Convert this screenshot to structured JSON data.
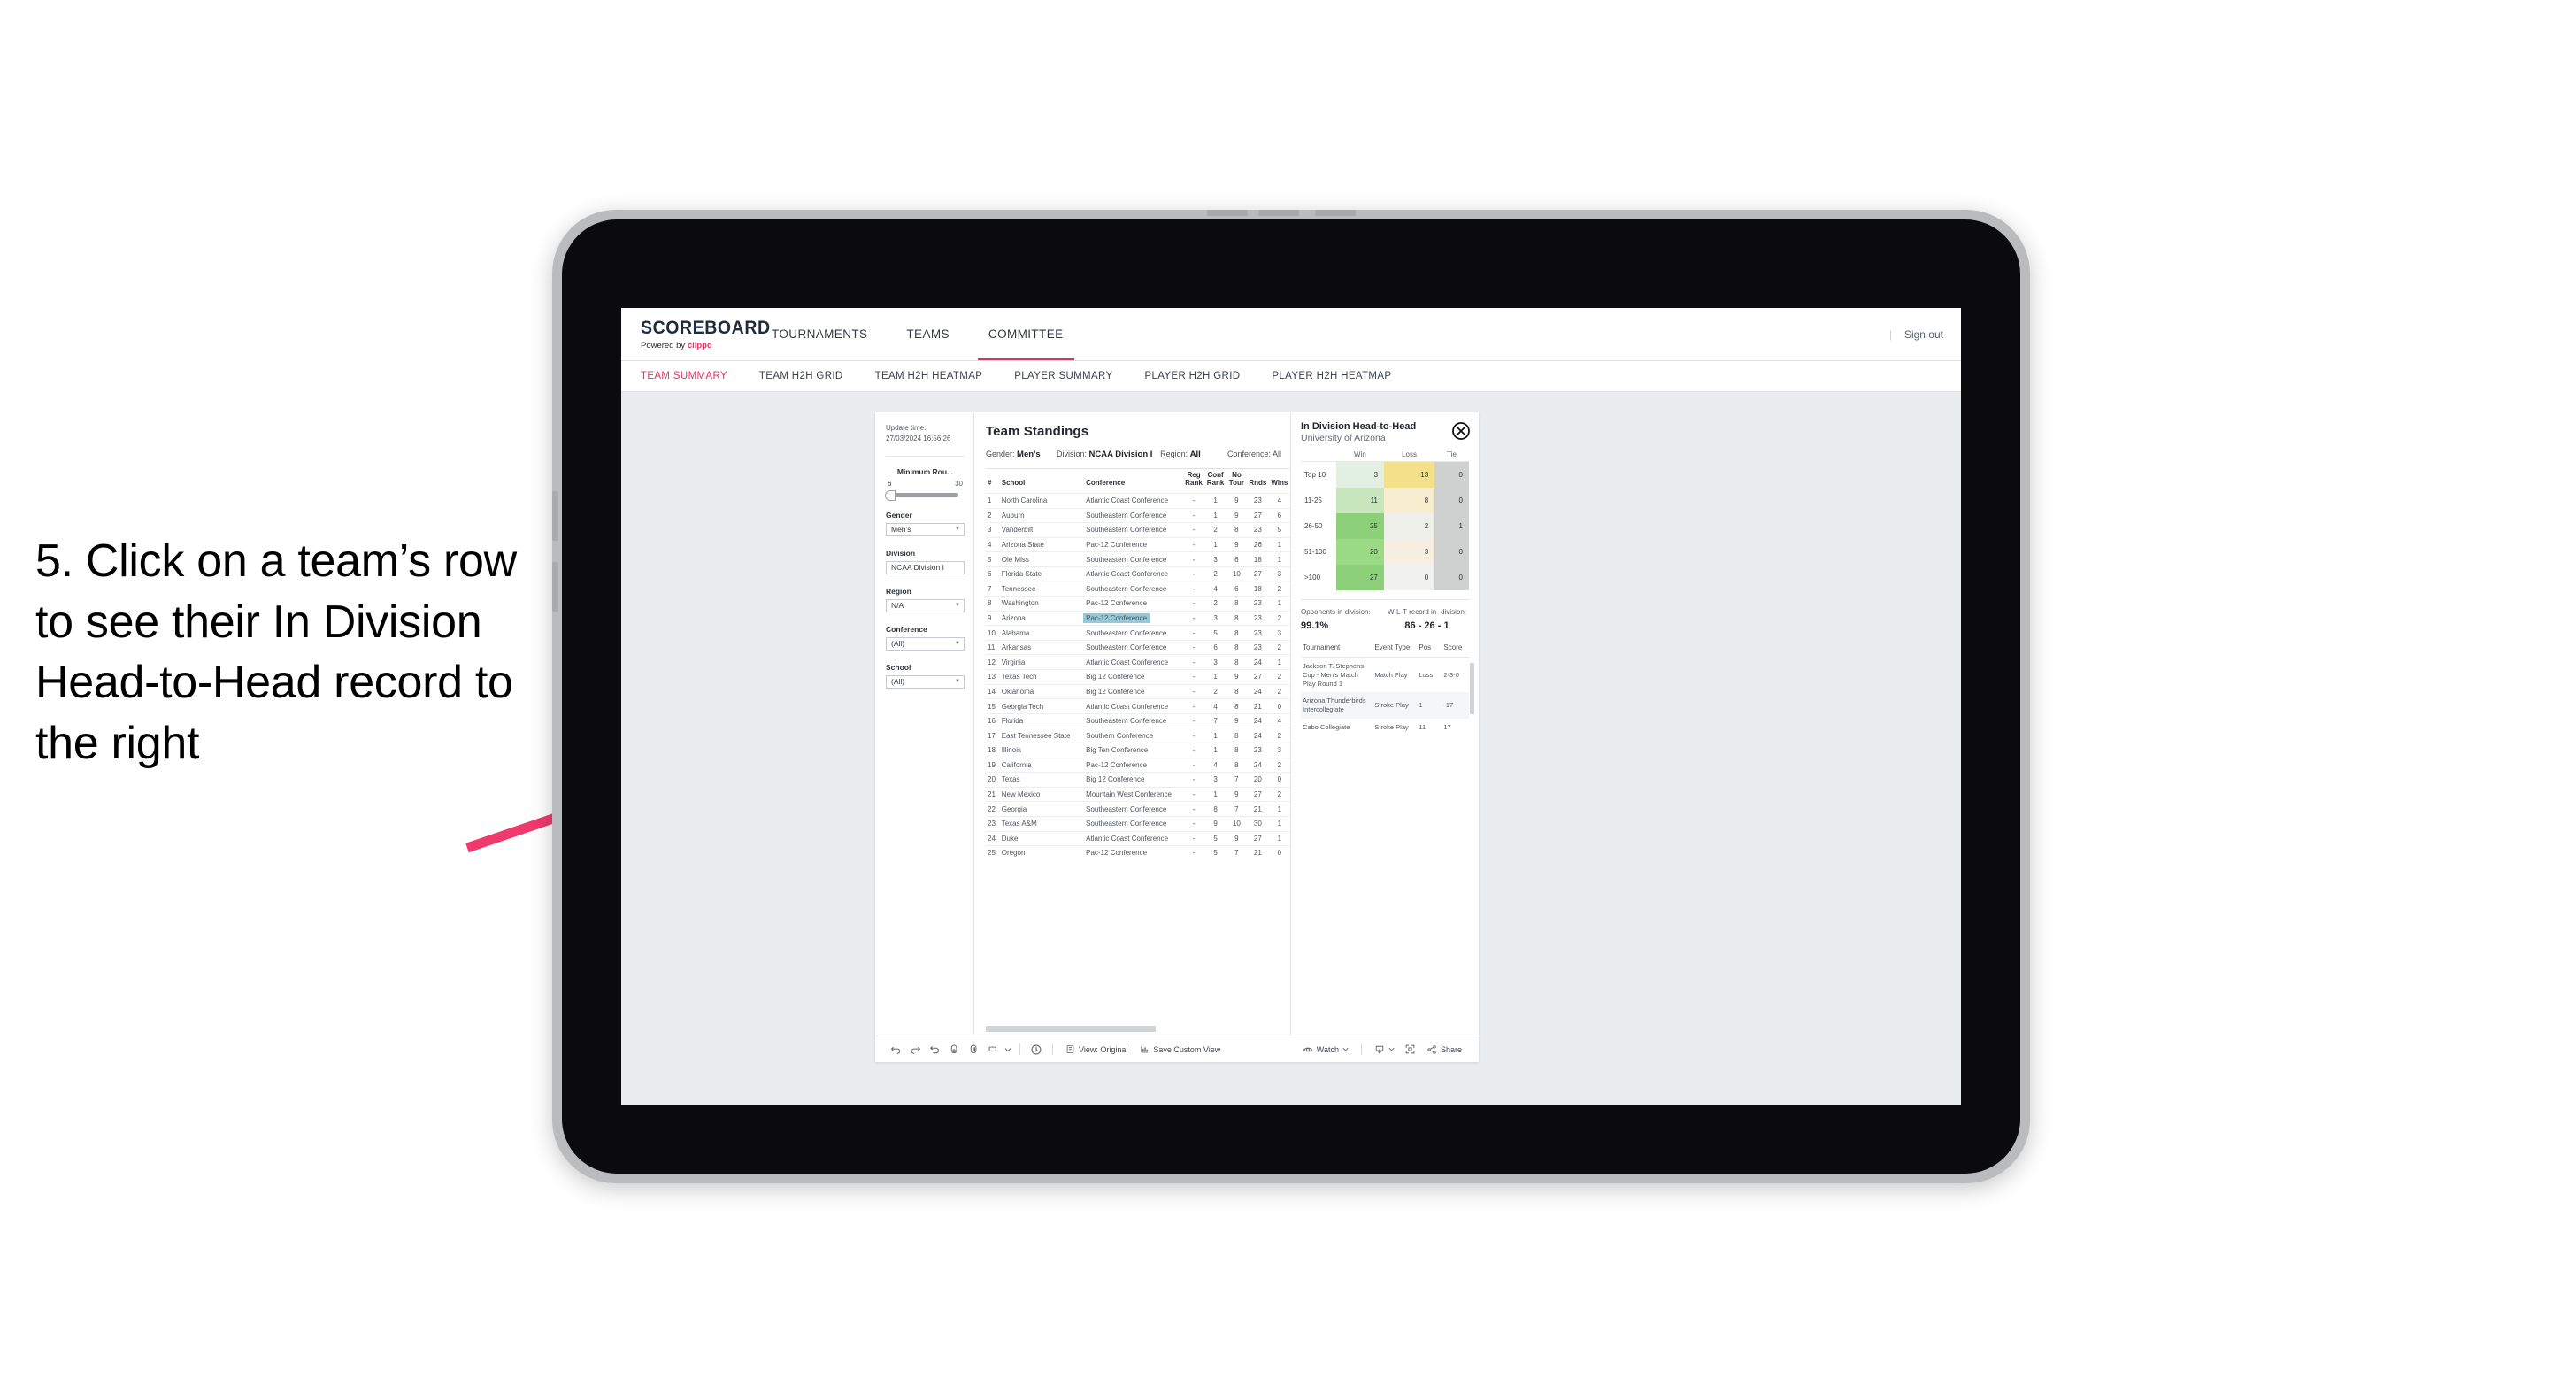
{
  "annotation": {
    "text": "5. Click on a team’s row to see their In Division Head-to-Head record to the right",
    "arrow_color": "#ef3a6e"
  },
  "navbar": {
    "brand_title": "SCOREBOARD",
    "brand_sub_prefix": "Powered by ",
    "brand_sub_name": "clippd",
    "items": [
      {
        "label": "TOURNAMENTS",
        "active": false
      },
      {
        "label": "TEAMS",
        "active": false
      },
      {
        "label": "COMMITTEE",
        "active": true
      }
    ],
    "divider": "|",
    "signout": "Sign out",
    "accent_color": "#c93a5b"
  },
  "subnav": {
    "items": [
      {
        "label": "TEAM SUMMARY",
        "active": true
      },
      {
        "label": "TEAM H2H GRID",
        "active": false
      },
      {
        "label": "TEAM H2H HEATMAP",
        "active": false
      },
      {
        "label": "PLAYER SUMMARY",
        "active": false
      },
      {
        "label": "PLAYER H2H GRID",
        "active": false
      },
      {
        "label": "PLAYER H2H HEATMAP",
        "active": false
      }
    ],
    "active_color": "#e8315e"
  },
  "filters": {
    "update_time_label": "Update time:",
    "update_time_value": "27/03/2024 16:56:26",
    "slider": {
      "label": "Minimum Rou...",
      "min": "6",
      "max": "30"
    },
    "selects": [
      {
        "label": "Gender",
        "value": "Men’s"
      },
      {
        "label": "Division",
        "value": "NCAA Division I"
      },
      {
        "label": "Region",
        "value": "N/A"
      },
      {
        "label": "Conference",
        "value": "(All)"
      },
      {
        "label": "School",
        "value": "(All)"
      }
    ]
  },
  "standings": {
    "title": "Team Standings",
    "summary": [
      {
        "label": "Gender:",
        "value": "Men’s"
      },
      {
        "label": "Division:",
        "value": "NCAA Division I"
      },
      {
        "label": "Region:",
        "value": "All"
      },
      {
        "label": "Conference:",
        "value": "All"
      }
    ],
    "columns": [
      "#",
      "School",
      "Conference",
      "Reg Rank",
      "Conf Rank",
      "No Tour",
      "Rnds",
      "Wins"
    ],
    "columns_multiline": [
      {
        "l1": "#",
        "l2": ""
      },
      {
        "l1": "School",
        "l2": ""
      },
      {
        "l1": "Conference",
        "l2": ""
      },
      {
        "l1": "Reg",
        "l2": "Rank"
      },
      {
        "l1": "Conf",
        "l2": "Rank"
      },
      {
        "l1": "No",
        "l2": "Tour"
      },
      {
        "l1": "Rnds",
        "l2": ""
      },
      {
        "l1": "Wins",
        "l2": ""
      }
    ],
    "highlight_color": "#93cada",
    "selected_row": 9,
    "rows": [
      {
        "rank": "1",
        "school": "North Carolina",
        "conference": "Atlantic Coast Conference",
        "reg": "-",
        "conf": "1",
        "notour": "9",
        "rnds": "23",
        "wins": "4"
      },
      {
        "rank": "2",
        "school": "Auburn",
        "conference": "Southeastern Conference",
        "reg": "-",
        "conf": "1",
        "notour": "9",
        "rnds": "27",
        "wins": "6"
      },
      {
        "rank": "3",
        "school": "Vanderbilt",
        "conference": "Southeastern Conference",
        "reg": "-",
        "conf": "2",
        "notour": "8",
        "rnds": "23",
        "wins": "5"
      },
      {
        "rank": "4",
        "school": "Arizona State",
        "conference": "Pac-12 Conference",
        "reg": "-",
        "conf": "1",
        "notour": "9",
        "rnds": "26",
        "wins": "1"
      },
      {
        "rank": "5",
        "school": "Ole Miss",
        "conference": "Southeastern Conference",
        "reg": "-",
        "conf": "3",
        "notour": "6",
        "rnds": "18",
        "wins": "1"
      },
      {
        "rank": "6",
        "school": "Florida State",
        "conference": "Atlantic Coast Conference",
        "reg": "-",
        "conf": "2",
        "notour": "10",
        "rnds": "27",
        "wins": "3"
      },
      {
        "rank": "7",
        "school": "Tennessee",
        "conference": "Southeastern Conference",
        "reg": "-",
        "conf": "4",
        "notour": "6",
        "rnds": "18",
        "wins": "2"
      },
      {
        "rank": "8",
        "school": "Washington",
        "conference": "Pac-12 Conference",
        "reg": "-",
        "conf": "2",
        "notour": "8",
        "rnds": "23",
        "wins": "1"
      },
      {
        "rank": "9",
        "school": "Arizona",
        "conference": "Pac-12 Conference",
        "reg": "-",
        "conf": "3",
        "notour": "8",
        "rnds": "23",
        "wins": "2"
      },
      {
        "rank": "10",
        "school": "Alabama",
        "conference": "Southeastern Conference",
        "reg": "-",
        "conf": "5",
        "notour": "8",
        "rnds": "23",
        "wins": "3"
      },
      {
        "rank": "11",
        "school": "Arkansas",
        "conference": "Southeastern Conference",
        "reg": "-",
        "conf": "6",
        "notour": "8",
        "rnds": "23",
        "wins": "2"
      },
      {
        "rank": "12",
        "school": "Virginia",
        "conference": "Atlantic Coast Conference",
        "reg": "-",
        "conf": "3",
        "notour": "8",
        "rnds": "24",
        "wins": "1"
      },
      {
        "rank": "13",
        "school": "Texas Tech",
        "conference": "Big 12 Conference",
        "reg": "-",
        "conf": "1",
        "notour": "9",
        "rnds": "27",
        "wins": "2"
      },
      {
        "rank": "14",
        "school": "Oklahoma",
        "conference": "Big 12 Conference",
        "reg": "-",
        "conf": "2",
        "notour": "8",
        "rnds": "24",
        "wins": "2"
      },
      {
        "rank": "15",
        "school": "Georgia Tech",
        "conference": "Atlantic Coast Conference",
        "reg": "-",
        "conf": "4",
        "notour": "8",
        "rnds": "21",
        "wins": "0"
      },
      {
        "rank": "16",
        "school": "Florida",
        "conference": "Southeastern Conference",
        "reg": "-",
        "conf": "7",
        "notour": "9",
        "rnds": "24",
        "wins": "4"
      },
      {
        "rank": "17",
        "school": "East Tennessee State",
        "conference": "Southern Conference",
        "reg": "-",
        "conf": "1",
        "notour": "8",
        "rnds": "24",
        "wins": "2"
      },
      {
        "rank": "18",
        "school": "Illinois",
        "conference": "Big Ten Conference",
        "reg": "-",
        "conf": "1",
        "notour": "8",
        "rnds": "23",
        "wins": "3"
      },
      {
        "rank": "19",
        "school": "California",
        "conference": "Pac-12 Conference",
        "reg": "-",
        "conf": "4",
        "notour": "8",
        "rnds": "24",
        "wins": "2"
      },
      {
        "rank": "20",
        "school": "Texas",
        "conference": "Big 12 Conference",
        "reg": "-",
        "conf": "3",
        "notour": "7",
        "rnds": "20",
        "wins": "0"
      },
      {
        "rank": "21",
        "school": "New Mexico",
        "conference": "Mountain West Conference",
        "reg": "-",
        "conf": "1",
        "notour": "9",
        "rnds": "27",
        "wins": "2"
      },
      {
        "rank": "22",
        "school": "Georgia",
        "conference": "Southeastern Conference",
        "reg": "-",
        "conf": "8",
        "notour": "7",
        "rnds": "21",
        "wins": "1"
      },
      {
        "rank": "23",
        "school": "Texas A&M",
        "conference": "Southeastern Conference",
        "reg": "-",
        "conf": "9",
        "notour": "10",
        "rnds": "30",
        "wins": "1"
      },
      {
        "rank": "24",
        "school": "Duke",
        "conference": "Atlantic Coast Conference",
        "reg": "-",
        "conf": "5",
        "notour": "9",
        "rnds": "27",
        "wins": "1"
      },
      {
        "rank": "25",
        "school": "Oregon",
        "conference": "Pac-12 Conference",
        "reg": "-",
        "conf": "5",
        "notour": "7",
        "rnds": "21",
        "wins": "0"
      }
    ]
  },
  "detail": {
    "title": "In Division Head-to-Head",
    "subtitle": "University of Arizona",
    "close_icon": "close-circle-icon",
    "h2h": {
      "columns": [
        "",
        "Win",
        "Loss",
        "Tie"
      ],
      "rows": [
        {
          "band": "Top 10",
          "win": "3",
          "loss": "13",
          "tie": "0",
          "win_color": "#e2efe3",
          "loss_color": "#f2e08a",
          "tie_color": "#cfd0d0"
        },
        {
          "band": "11-25",
          "win": "11",
          "loss": "8",
          "tie": "0",
          "win_color": "#c8e6bd",
          "loss_color": "#f7eed0",
          "tie_color": "#cfd0d0"
        },
        {
          "band": "26-50",
          "win": "25",
          "loss": "2",
          "tie": "1",
          "win_color": "#8cd079",
          "loss_color": "#f0f0eb",
          "tie_color": "#cfd0d0"
        },
        {
          "band": "51-100",
          "win": "20",
          "loss": "3",
          "tie": "0",
          "win_color": "#9ada85",
          "loss_color": "#f6efe2",
          "tie_color": "#cfd0d0"
        },
        {
          "band": ">100",
          "win": "27",
          "loss": "0",
          "tie": "0",
          "win_color": "#8cd079",
          "loss_color": "#f1f1ef",
          "tie_color": "#cfd0d0"
        }
      ]
    },
    "summary": {
      "opponents_label": "Opponents in division:",
      "opponents_value": "99.1%",
      "record_label": "W-L-T record in -division:",
      "record_value": "86 - 26 - 1"
    },
    "tournaments": {
      "columns": [
        "Tournament",
        "Event Type",
        "Pos",
        "Score"
      ],
      "rows": [
        {
          "name": "Jackson T. Stephens Cup - Men’s Match Play Round 1",
          "type": "Match Play",
          "pos": "Loss",
          "score": "2-3-0"
        },
        {
          "name": "Arizona Thunderbirds Intercollegiate",
          "type": "Stroke Play",
          "pos": "1",
          "score": "-17"
        },
        {
          "name": "Cabo Collegiate",
          "type": "Stroke Play",
          "pos": "11",
          "score": "17"
        }
      ]
    }
  },
  "toolbar": {
    "icons": [
      "undo-icon",
      "redo-icon",
      "revert-icon",
      "refresh-data-icon",
      "pause-icon",
      "layout-icon",
      "chevron-down-icon",
      "history-icon"
    ],
    "view_label": "View: Original",
    "save_label": "Save Custom View",
    "watch_label": "Watch",
    "share_label": "Share"
  }
}
